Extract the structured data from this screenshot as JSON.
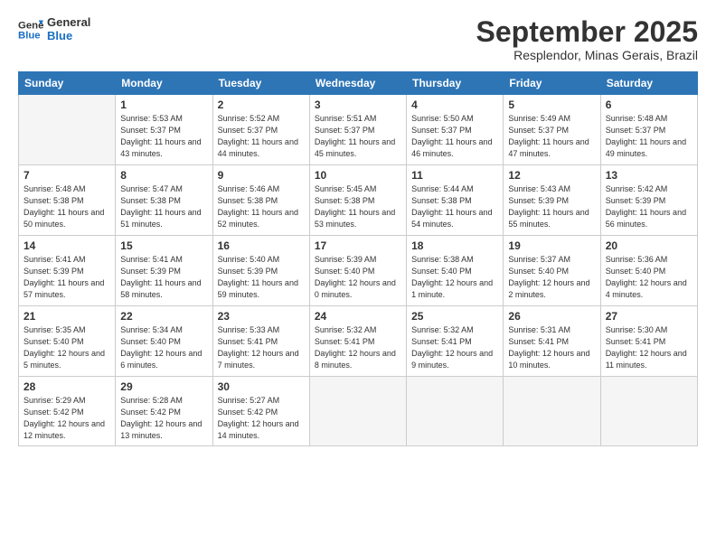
{
  "header": {
    "logo_line1": "General",
    "logo_line2": "Blue",
    "month": "September 2025",
    "location": "Resplendor, Minas Gerais, Brazil"
  },
  "weekdays": [
    "Sunday",
    "Monday",
    "Tuesday",
    "Wednesday",
    "Thursday",
    "Friday",
    "Saturday"
  ],
  "weeks": [
    [
      {
        "day": "",
        "empty": true
      },
      {
        "day": "1",
        "sunrise": "5:53 AM",
        "sunset": "5:37 PM",
        "daylight": "11 hours and 43 minutes."
      },
      {
        "day": "2",
        "sunrise": "5:52 AM",
        "sunset": "5:37 PM",
        "daylight": "11 hours and 44 minutes."
      },
      {
        "day": "3",
        "sunrise": "5:51 AM",
        "sunset": "5:37 PM",
        "daylight": "11 hours and 45 minutes."
      },
      {
        "day": "4",
        "sunrise": "5:50 AM",
        "sunset": "5:37 PM",
        "daylight": "11 hours and 46 minutes."
      },
      {
        "day": "5",
        "sunrise": "5:49 AM",
        "sunset": "5:37 PM",
        "daylight": "11 hours and 47 minutes."
      },
      {
        "day": "6",
        "sunrise": "5:48 AM",
        "sunset": "5:37 PM",
        "daylight": "11 hours and 49 minutes."
      }
    ],
    [
      {
        "day": "7",
        "sunrise": "5:48 AM",
        "sunset": "5:38 PM",
        "daylight": "11 hours and 50 minutes."
      },
      {
        "day": "8",
        "sunrise": "5:47 AM",
        "sunset": "5:38 PM",
        "daylight": "11 hours and 51 minutes."
      },
      {
        "day": "9",
        "sunrise": "5:46 AM",
        "sunset": "5:38 PM",
        "daylight": "11 hours and 52 minutes."
      },
      {
        "day": "10",
        "sunrise": "5:45 AM",
        "sunset": "5:38 PM",
        "daylight": "11 hours and 53 minutes."
      },
      {
        "day": "11",
        "sunrise": "5:44 AM",
        "sunset": "5:38 PM",
        "daylight": "11 hours and 54 minutes."
      },
      {
        "day": "12",
        "sunrise": "5:43 AM",
        "sunset": "5:39 PM",
        "daylight": "11 hours and 55 minutes."
      },
      {
        "day": "13",
        "sunrise": "5:42 AM",
        "sunset": "5:39 PM",
        "daylight": "11 hours and 56 minutes."
      }
    ],
    [
      {
        "day": "14",
        "sunrise": "5:41 AM",
        "sunset": "5:39 PM",
        "daylight": "11 hours and 57 minutes."
      },
      {
        "day": "15",
        "sunrise": "5:41 AM",
        "sunset": "5:39 PM",
        "daylight": "11 hours and 58 minutes."
      },
      {
        "day": "16",
        "sunrise": "5:40 AM",
        "sunset": "5:39 PM",
        "daylight": "11 hours and 59 minutes."
      },
      {
        "day": "17",
        "sunrise": "5:39 AM",
        "sunset": "5:40 PM",
        "daylight": "12 hours and 0 minutes."
      },
      {
        "day": "18",
        "sunrise": "5:38 AM",
        "sunset": "5:40 PM",
        "daylight": "12 hours and 1 minute."
      },
      {
        "day": "19",
        "sunrise": "5:37 AM",
        "sunset": "5:40 PM",
        "daylight": "12 hours and 2 minutes."
      },
      {
        "day": "20",
        "sunrise": "5:36 AM",
        "sunset": "5:40 PM",
        "daylight": "12 hours and 4 minutes."
      }
    ],
    [
      {
        "day": "21",
        "sunrise": "5:35 AM",
        "sunset": "5:40 PM",
        "daylight": "12 hours and 5 minutes."
      },
      {
        "day": "22",
        "sunrise": "5:34 AM",
        "sunset": "5:40 PM",
        "daylight": "12 hours and 6 minutes."
      },
      {
        "day": "23",
        "sunrise": "5:33 AM",
        "sunset": "5:41 PM",
        "daylight": "12 hours and 7 minutes."
      },
      {
        "day": "24",
        "sunrise": "5:32 AM",
        "sunset": "5:41 PM",
        "daylight": "12 hours and 8 minutes."
      },
      {
        "day": "25",
        "sunrise": "5:32 AM",
        "sunset": "5:41 PM",
        "daylight": "12 hours and 9 minutes."
      },
      {
        "day": "26",
        "sunrise": "5:31 AM",
        "sunset": "5:41 PM",
        "daylight": "12 hours and 10 minutes."
      },
      {
        "day": "27",
        "sunrise": "5:30 AM",
        "sunset": "5:41 PM",
        "daylight": "12 hours and 11 minutes."
      }
    ],
    [
      {
        "day": "28",
        "sunrise": "5:29 AM",
        "sunset": "5:42 PM",
        "daylight": "12 hours and 12 minutes."
      },
      {
        "day": "29",
        "sunrise": "5:28 AM",
        "sunset": "5:42 PM",
        "daylight": "12 hours and 13 minutes."
      },
      {
        "day": "30",
        "sunrise": "5:27 AM",
        "sunset": "5:42 PM",
        "daylight": "12 hours and 14 minutes."
      },
      {
        "day": "",
        "empty": true
      },
      {
        "day": "",
        "empty": true
      },
      {
        "day": "",
        "empty": true
      },
      {
        "day": "",
        "empty": true
      }
    ]
  ],
  "labels": {
    "sunrise": "Sunrise:",
    "sunset": "Sunset:",
    "daylight": "Daylight:"
  }
}
